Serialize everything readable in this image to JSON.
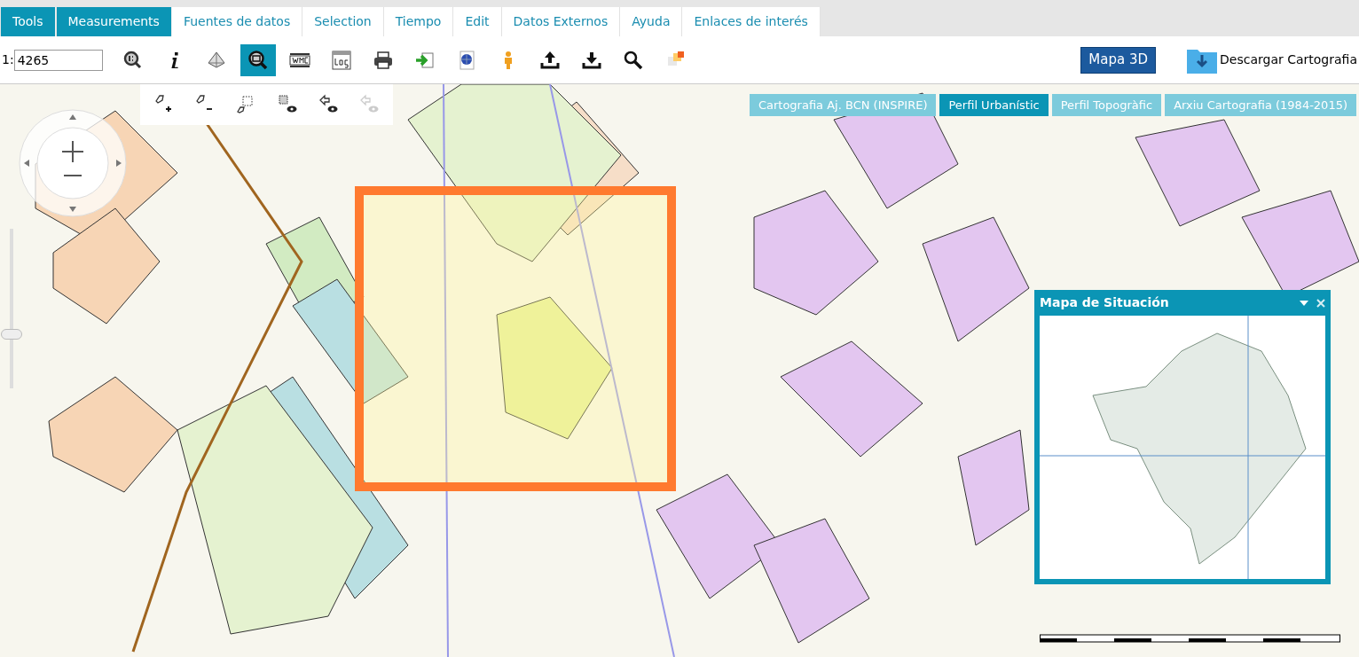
{
  "menu_tabs": [
    {
      "label": "Tools",
      "selected": true
    },
    {
      "label": "Measurements",
      "selected": true
    },
    {
      "label": "Fuentes de datos",
      "selected": false
    },
    {
      "label": "Selection",
      "selected": false
    },
    {
      "label": "Tiempo",
      "selected": false
    },
    {
      "label": "Edit",
      "selected": false
    },
    {
      "label": "Datos Externos",
      "selected": false
    },
    {
      "label": "Ayuda",
      "selected": false
    },
    {
      "label": "Enlaces de interés",
      "selected": false
    }
  ],
  "scale": {
    "prefix": "1:",
    "value": "4265"
  },
  "tools": [
    {
      "kind": "zoom-scale",
      "selected": false
    },
    {
      "kind": "info",
      "selected": false
    },
    {
      "kind": "pyramid",
      "selected": false
    },
    {
      "kind": "zoom-box",
      "selected": true
    },
    {
      "kind": "wmc",
      "selected": false
    },
    {
      "kind": "log",
      "selected": false
    },
    {
      "kind": "print",
      "selected": false
    },
    {
      "kind": "import",
      "selected": false
    },
    {
      "kind": "globe",
      "selected": false
    },
    {
      "kind": "person",
      "selected": false
    },
    {
      "kind": "upload",
      "selected": false
    },
    {
      "kind": "download",
      "selected": false
    },
    {
      "kind": "search",
      "selected": false
    },
    {
      "kind": "squares",
      "selected": false
    }
  ],
  "map_3d_button": "Mapa 3D",
  "download_cartography": "Descargar Cartografia",
  "layer_tabs": [
    {
      "label": "Cartografia Aj. BCN (INSPIRE)",
      "selected": false
    },
    {
      "label": "Perfil Urbanístic",
      "selected": true
    },
    {
      "label": "Perfil Topogràfic",
      "selected": false
    },
    {
      "label": "Arxiu Cartografia (1984-2015)",
      "selected": false
    }
  ],
  "edit_tools": [
    {
      "kind": "add-polygon",
      "disabled": false
    },
    {
      "kind": "remove-polygon",
      "disabled": false
    },
    {
      "kind": "polygon-box",
      "disabled": false
    },
    {
      "kind": "view-selection",
      "disabled": false
    },
    {
      "kind": "view-arrow",
      "disabled": false
    },
    {
      "kind": "view-arrow",
      "disabled": true
    }
  ],
  "zoom_slider": {
    "level": 0.34
  },
  "situation_panel": {
    "title": "Mapa de Situación"
  }
}
